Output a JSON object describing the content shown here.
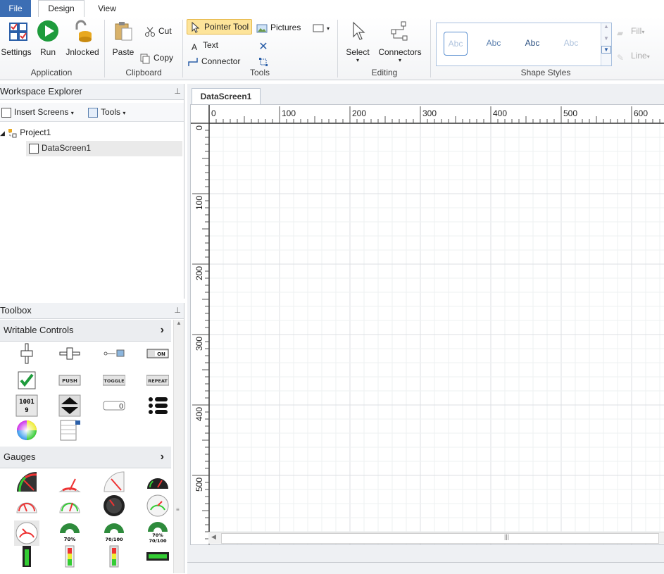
{
  "tabs": {
    "file": "File",
    "design": "Design",
    "view": "View"
  },
  "ribbon": {
    "application": {
      "label": "Application",
      "settings": "Settings",
      "run": "Run",
      "unlocked": "Jnlocked"
    },
    "clipboard": {
      "label": "Clipboard",
      "paste": "Paste",
      "cut": "Cut",
      "copy": "Copy"
    },
    "tools": {
      "label": "Tools",
      "pointer": "Pointer Tool",
      "pictures": "Pictures",
      "text": "Text",
      "connector": "Connector"
    },
    "editing": {
      "label": "Editing",
      "select": "Select",
      "connectors": "Connectors"
    },
    "shape_styles": {
      "label": "Shape Styles",
      "sample": "Abc",
      "fill": "Fill",
      "line": "Line"
    }
  },
  "workspace": {
    "title": "Workspace Explorer",
    "insert_screens": "Insert Screens",
    "tools": "Tools",
    "project": "Project1",
    "screen": "DataScreen1"
  },
  "toolbox": {
    "title": "Toolbox",
    "writable": "Writable Controls",
    "gauges": "Gauges",
    "labels": {
      "push": "PUSH",
      "toggle": "TOGGLE",
      "repeat": "REPEAT",
      "on": "ON",
      "zero": "0",
      "binary": "1001",
      "nine": "9",
      "p70": "70%",
      "p70_100": "70/100"
    }
  },
  "document": {
    "tab": "DataScreen1",
    "ruler_h": [
      "0",
      "100",
      "200",
      "300",
      "400",
      "500",
      "600"
    ],
    "ruler_v": [
      "0",
      "100",
      "200",
      "300",
      "400",
      "500"
    ],
    "hscroll_grip": "|||"
  },
  "colors": {
    "accent": "#3c6eb4",
    "highlight": "#fde49a",
    "grid": "#e6e8eb"
  }
}
